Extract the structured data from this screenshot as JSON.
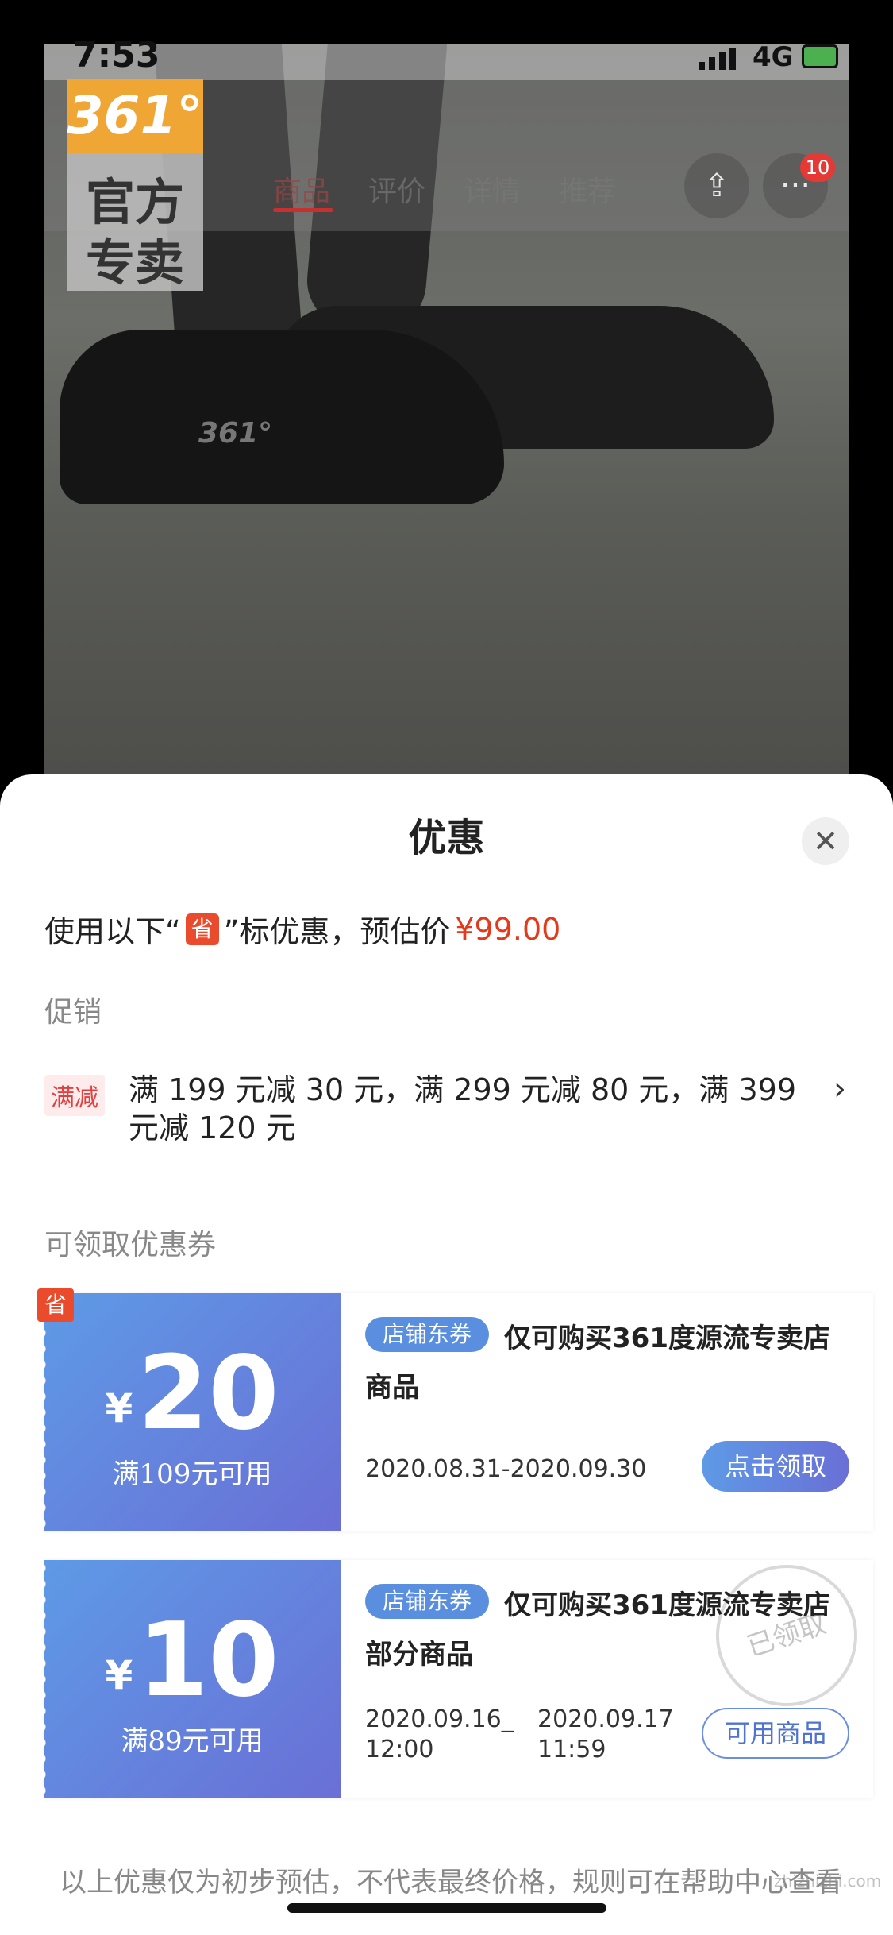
{
  "status_bar": {
    "time": "7:53",
    "network": "4G"
  },
  "brand_badge": {
    "logo": "361°",
    "line1": "官方",
    "line2": "专卖"
  },
  "nav": {
    "tabs": [
      "商品",
      "评价",
      "详情",
      "推荐"
    ],
    "active_tab": "商品",
    "share_icon": "share-icon",
    "more_icon": "more-icon",
    "more_badge": "10"
  },
  "sheet": {
    "title": "优惠",
    "close_icon": "close-icon",
    "estimate_prefix": "使用以下“",
    "save_chip": "省",
    "estimate_suffix": "”标优惠，预估价",
    "estimate_price": "¥99.00",
    "promo_section": "促销",
    "promo_tag": "满减",
    "promo_text": "满 199 元减 30 元，满 299 元减 80 元，满 399 元减 120 元",
    "coupon_section": "可领取优惠券",
    "footer_note": "以上优惠仅为初步预估，不代表最终价格，规则可在帮助中心查看"
  },
  "coupons": [
    {
      "currency": "¥",
      "amount": "20",
      "threshold": "满109元可用",
      "save_badge": "省",
      "tag": "店铺东券",
      "title": "仅可购买361度源流专卖店商品",
      "validity": "2020.08.31-2020.09.30",
      "button": "点击领取"
    },
    {
      "currency": "¥",
      "amount": "10",
      "threshold": "满89元可用",
      "tag": "店铺东券",
      "title": "仅可购买361度源流专卖店部分商品",
      "validity_start": "2020.09.16_",
      "validity_start_time": "12:00",
      "validity_end": "2020.09.17",
      "validity_end_time": "11:59",
      "stamp": "已领取",
      "button": "可用商品"
    }
  ],
  "watermark": "zhizhizhi.com",
  "colors": {
    "accent_red": "#e23a1b",
    "coupon_blue": "#5e9ae6",
    "coupon_purple": "#6a6fd6"
  }
}
